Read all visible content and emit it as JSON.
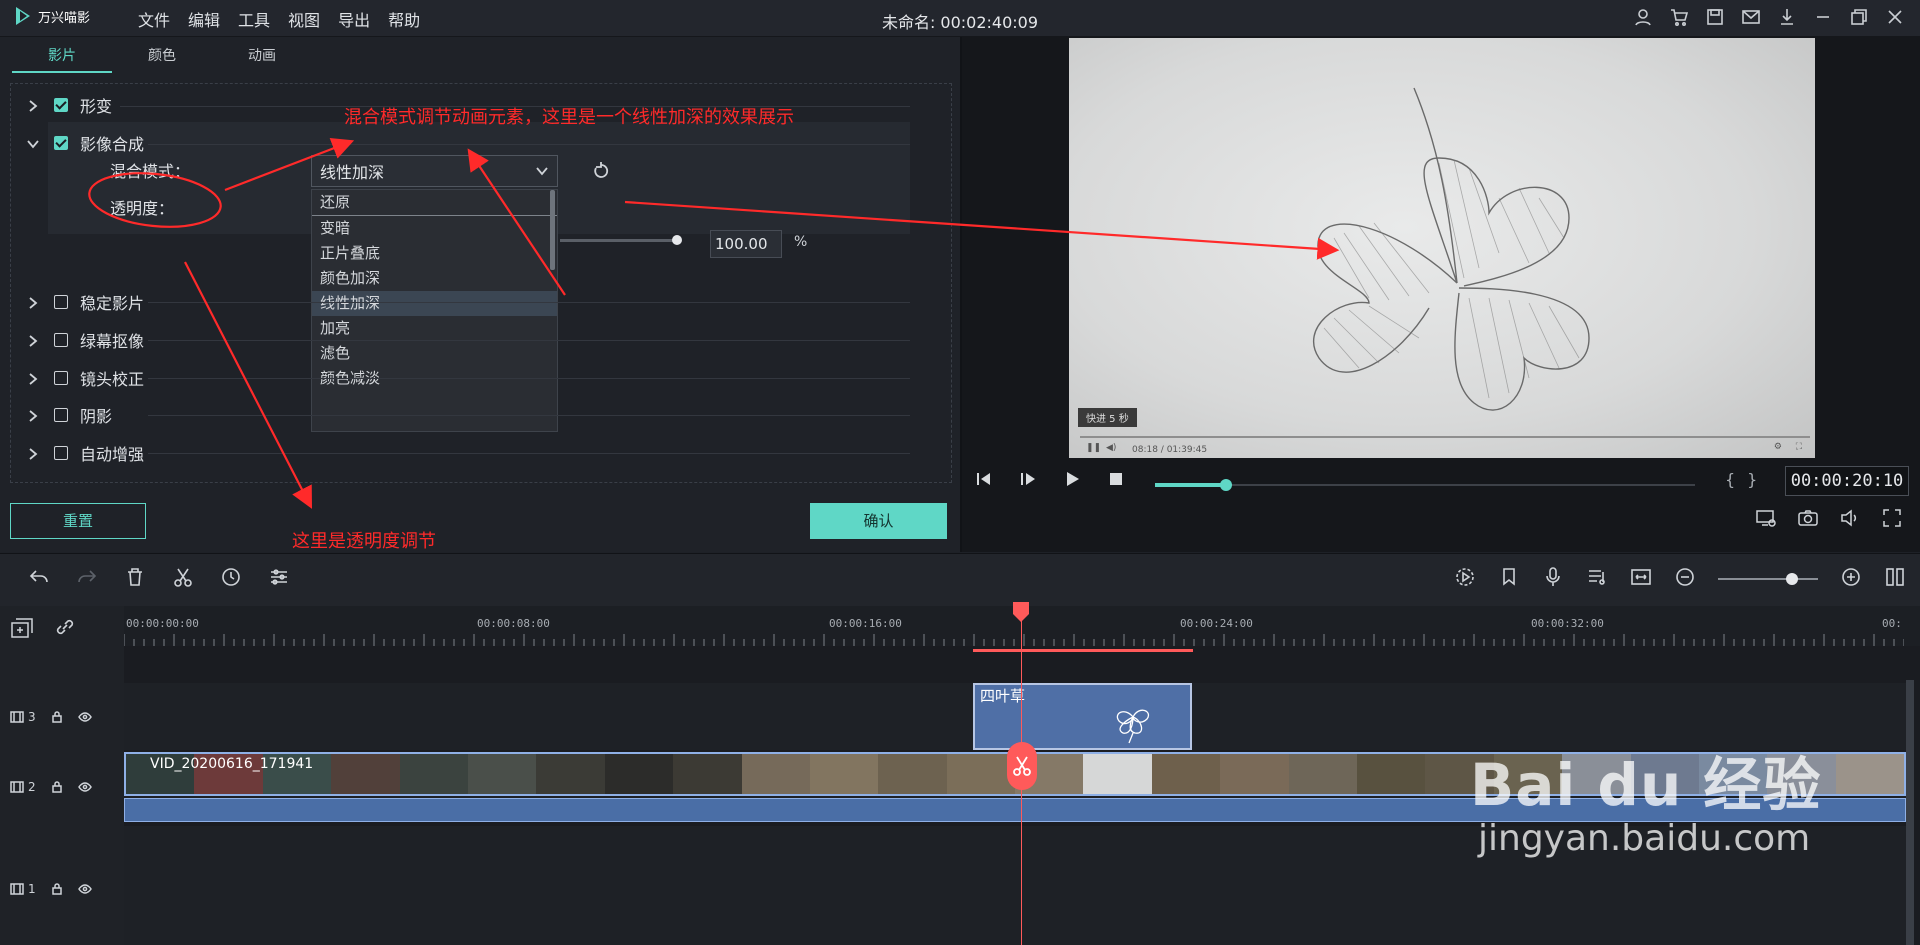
{
  "app": {
    "logo_text": "万兴喵影",
    "doc_title": "未命名: 00:02:40:09"
  },
  "menu": [
    "文件",
    "编辑",
    "工具",
    "视图",
    "导出",
    "帮助"
  ],
  "left_panel": {
    "tabs": [
      "影片",
      "颜色",
      "动画"
    ],
    "props": [
      {
        "label": "形变",
        "checked": true,
        "expanded": false
      },
      {
        "label": "影像合成",
        "checked": true,
        "expanded": true
      },
      {
        "label": "稳定影片",
        "checked": false,
        "expanded": false
      },
      {
        "label": "绿幕抠像",
        "checked": false,
        "expanded": false
      },
      {
        "label": "镜头校正",
        "checked": false,
        "expanded": false
      },
      {
        "label": "阴影",
        "checked": false,
        "expanded": false
      },
      {
        "label": "自动增强",
        "checked": false,
        "expanded": false
      }
    ],
    "blend_label": "混合模式：",
    "blend_value": "线性加深",
    "opacity_label": "透明度：",
    "opacity_value": "100.00",
    "opacity_unit": "%",
    "opacity_level": 1.0,
    "dropdown_options": [
      "还原",
      "变暗",
      "正片叠底",
      "颜色加深",
      "线性加深",
      "加亮",
      "滤色",
      "颜色减淡"
    ],
    "dropdown_selected": "线性加深",
    "reset_label": "重置",
    "ok_label": "确认"
  },
  "preview": {
    "frame_badge": "快进 5 秒",
    "frame_time": "08:18 / 01:39:45",
    "timecode": "00:00:20:10",
    "progress": 0.13
  },
  "timeline": {
    "ruler_labels": [
      "00:00:00:00",
      "00:00:08:00",
      "00:00:16:00",
      "00:00:24:00",
      "00:00:32:00",
      "00:"
    ],
    "tracks": [
      {
        "num": "3"
      },
      {
        "num": "2"
      },
      {
        "num": "1"
      }
    ],
    "text_clip": "四叶草",
    "video_clip": "VID_20200616_171941"
  },
  "annotations": {
    "top": "混合模式调节动画元素，这里是一个线性加深的效果展示",
    "bottom": "这里是透明度调节"
  },
  "watermark": {
    "brand": "Bai du 经验",
    "url": "jingyan.baidu.com"
  },
  "colors": {
    "accent": "#5fd7c6",
    "annotation": "#ff2a2a",
    "clip_blue": "#4f6fa6"
  }
}
